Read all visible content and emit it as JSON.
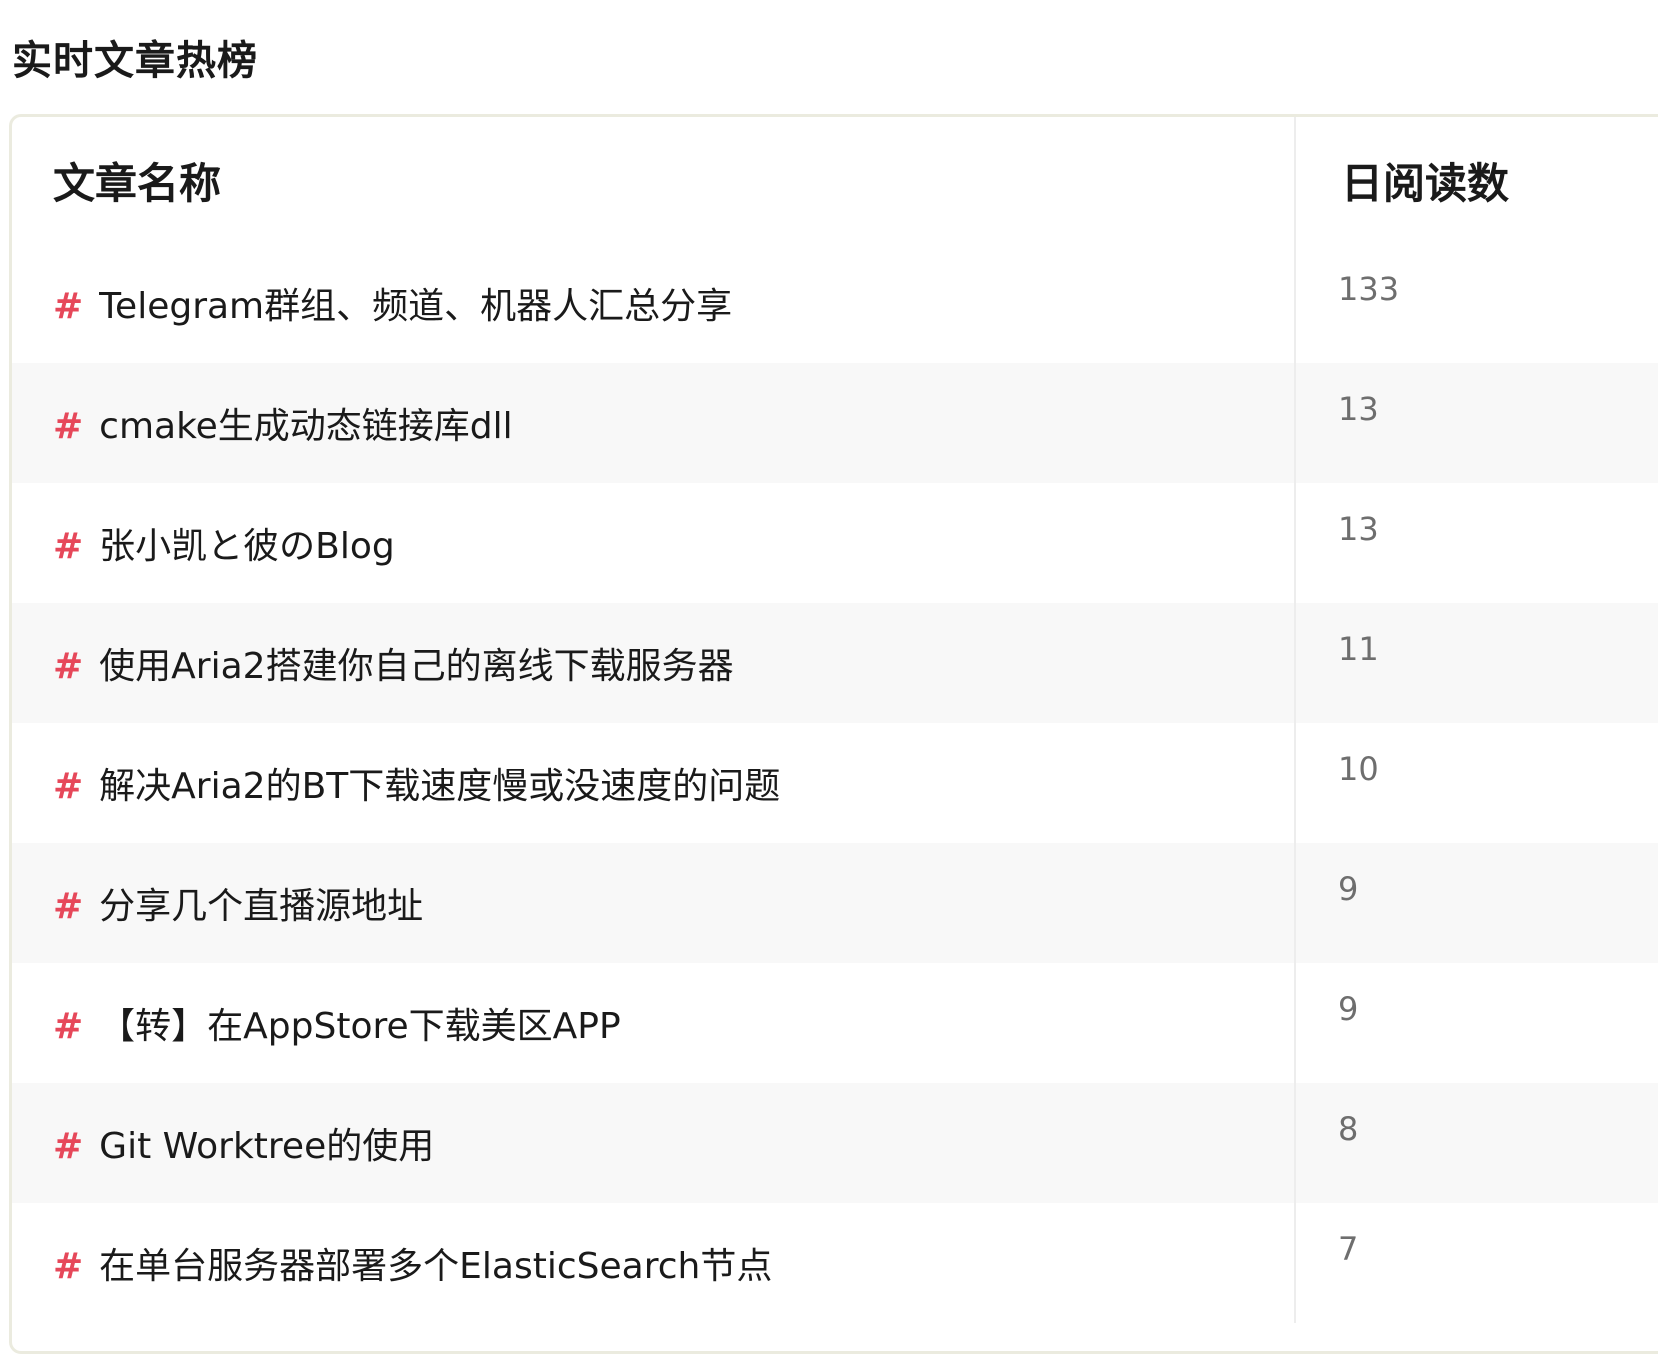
{
  "section": {
    "title": "实时文章热榜"
  },
  "table": {
    "headers": {
      "name": "文章名称",
      "reads": "日阅读数"
    },
    "rows": [
      {
        "marker": "#",
        "title": "Telegram群组、频道、机器人汇总分享",
        "reads": "133"
      },
      {
        "marker": "#",
        "title": "cmake生成动态链接库dll",
        "reads": "13"
      },
      {
        "marker": "#",
        "title": "张小凯と彼のBlog",
        "reads": "13"
      },
      {
        "marker": "#",
        "title": "使用Aria2搭建你自己的离线下载服务器",
        "reads": "11"
      },
      {
        "marker": "#",
        "title": "解决Aria2的BT下载速度慢或没速度的问题",
        "reads": "10"
      },
      {
        "marker": "#",
        "title": "分享几个直播源地址",
        "reads": "9"
      },
      {
        "marker": "#",
        "title": "【转】在AppStore下载美区APP",
        "reads": "9"
      },
      {
        "marker": "#",
        "title": "Git Worktree的使用",
        "reads": "8"
      },
      {
        "marker": "#",
        "title": "在单台服务器部署多个ElasticSearch节点",
        "reads": "7"
      }
    ]
  },
  "colors": {
    "accent": "#e6485a",
    "stripe": "#f8f8f8",
    "border": "#ebebdf"
  }
}
